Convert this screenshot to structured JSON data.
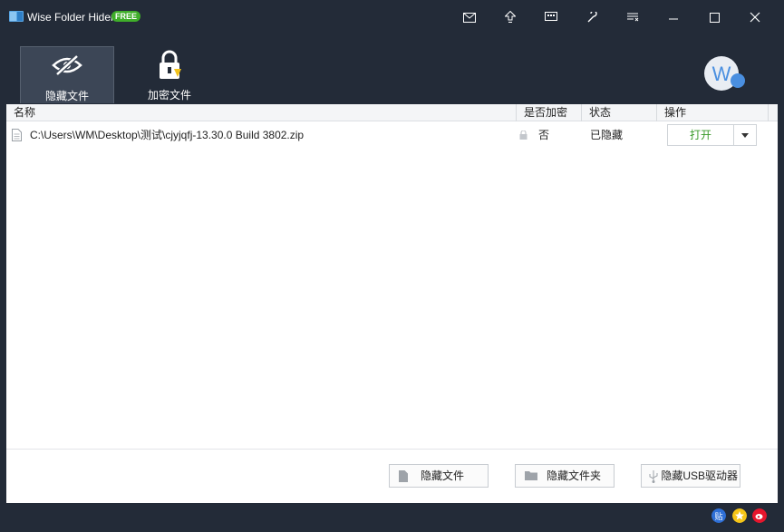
{
  "window": {
    "title": "Wise Folder Hider",
    "badge": "FREE"
  },
  "titlebar_icons": [
    "mail-icon",
    "upgrade-icon",
    "feedback-icon",
    "settings-icon",
    "menu-icon",
    "minimize-icon",
    "maximize-icon",
    "close-icon"
  ],
  "tabs": [
    {
      "label": "隐藏文件",
      "icon": "eye-slash-icon",
      "active": true
    },
    {
      "label": "加密文件",
      "icon": "lock-icon",
      "active": false
    }
  ],
  "logo_letter": "W",
  "table": {
    "columns": [
      "名称",
      "是否加密",
      "状态",
      "操作"
    ],
    "rows": [
      {
        "path": "C:\\Users\\WM\\Desktop\\测试\\cjyjqfj-13.30.0 Build 3802.zip",
        "encrypted": "否",
        "status": "已隐藏",
        "action": "打开"
      }
    ]
  },
  "bottom_buttons": [
    {
      "label": "隐藏文件",
      "icon": "file-icon"
    },
    {
      "label": "隐藏文件夹",
      "icon": "folder-icon"
    },
    {
      "label": "隐藏USB驱动器",
      "icon": "usb-icon"
    }
  ],
  "social_icons": [
    "tieba-icon",
    "star-icon",
    "weibo-icon"
  ],
  "colors": {
    "frame": "#232b38",
    "accent_green": "#3fae2a",
    "open_text": "#3a9a2a"
  }
}
